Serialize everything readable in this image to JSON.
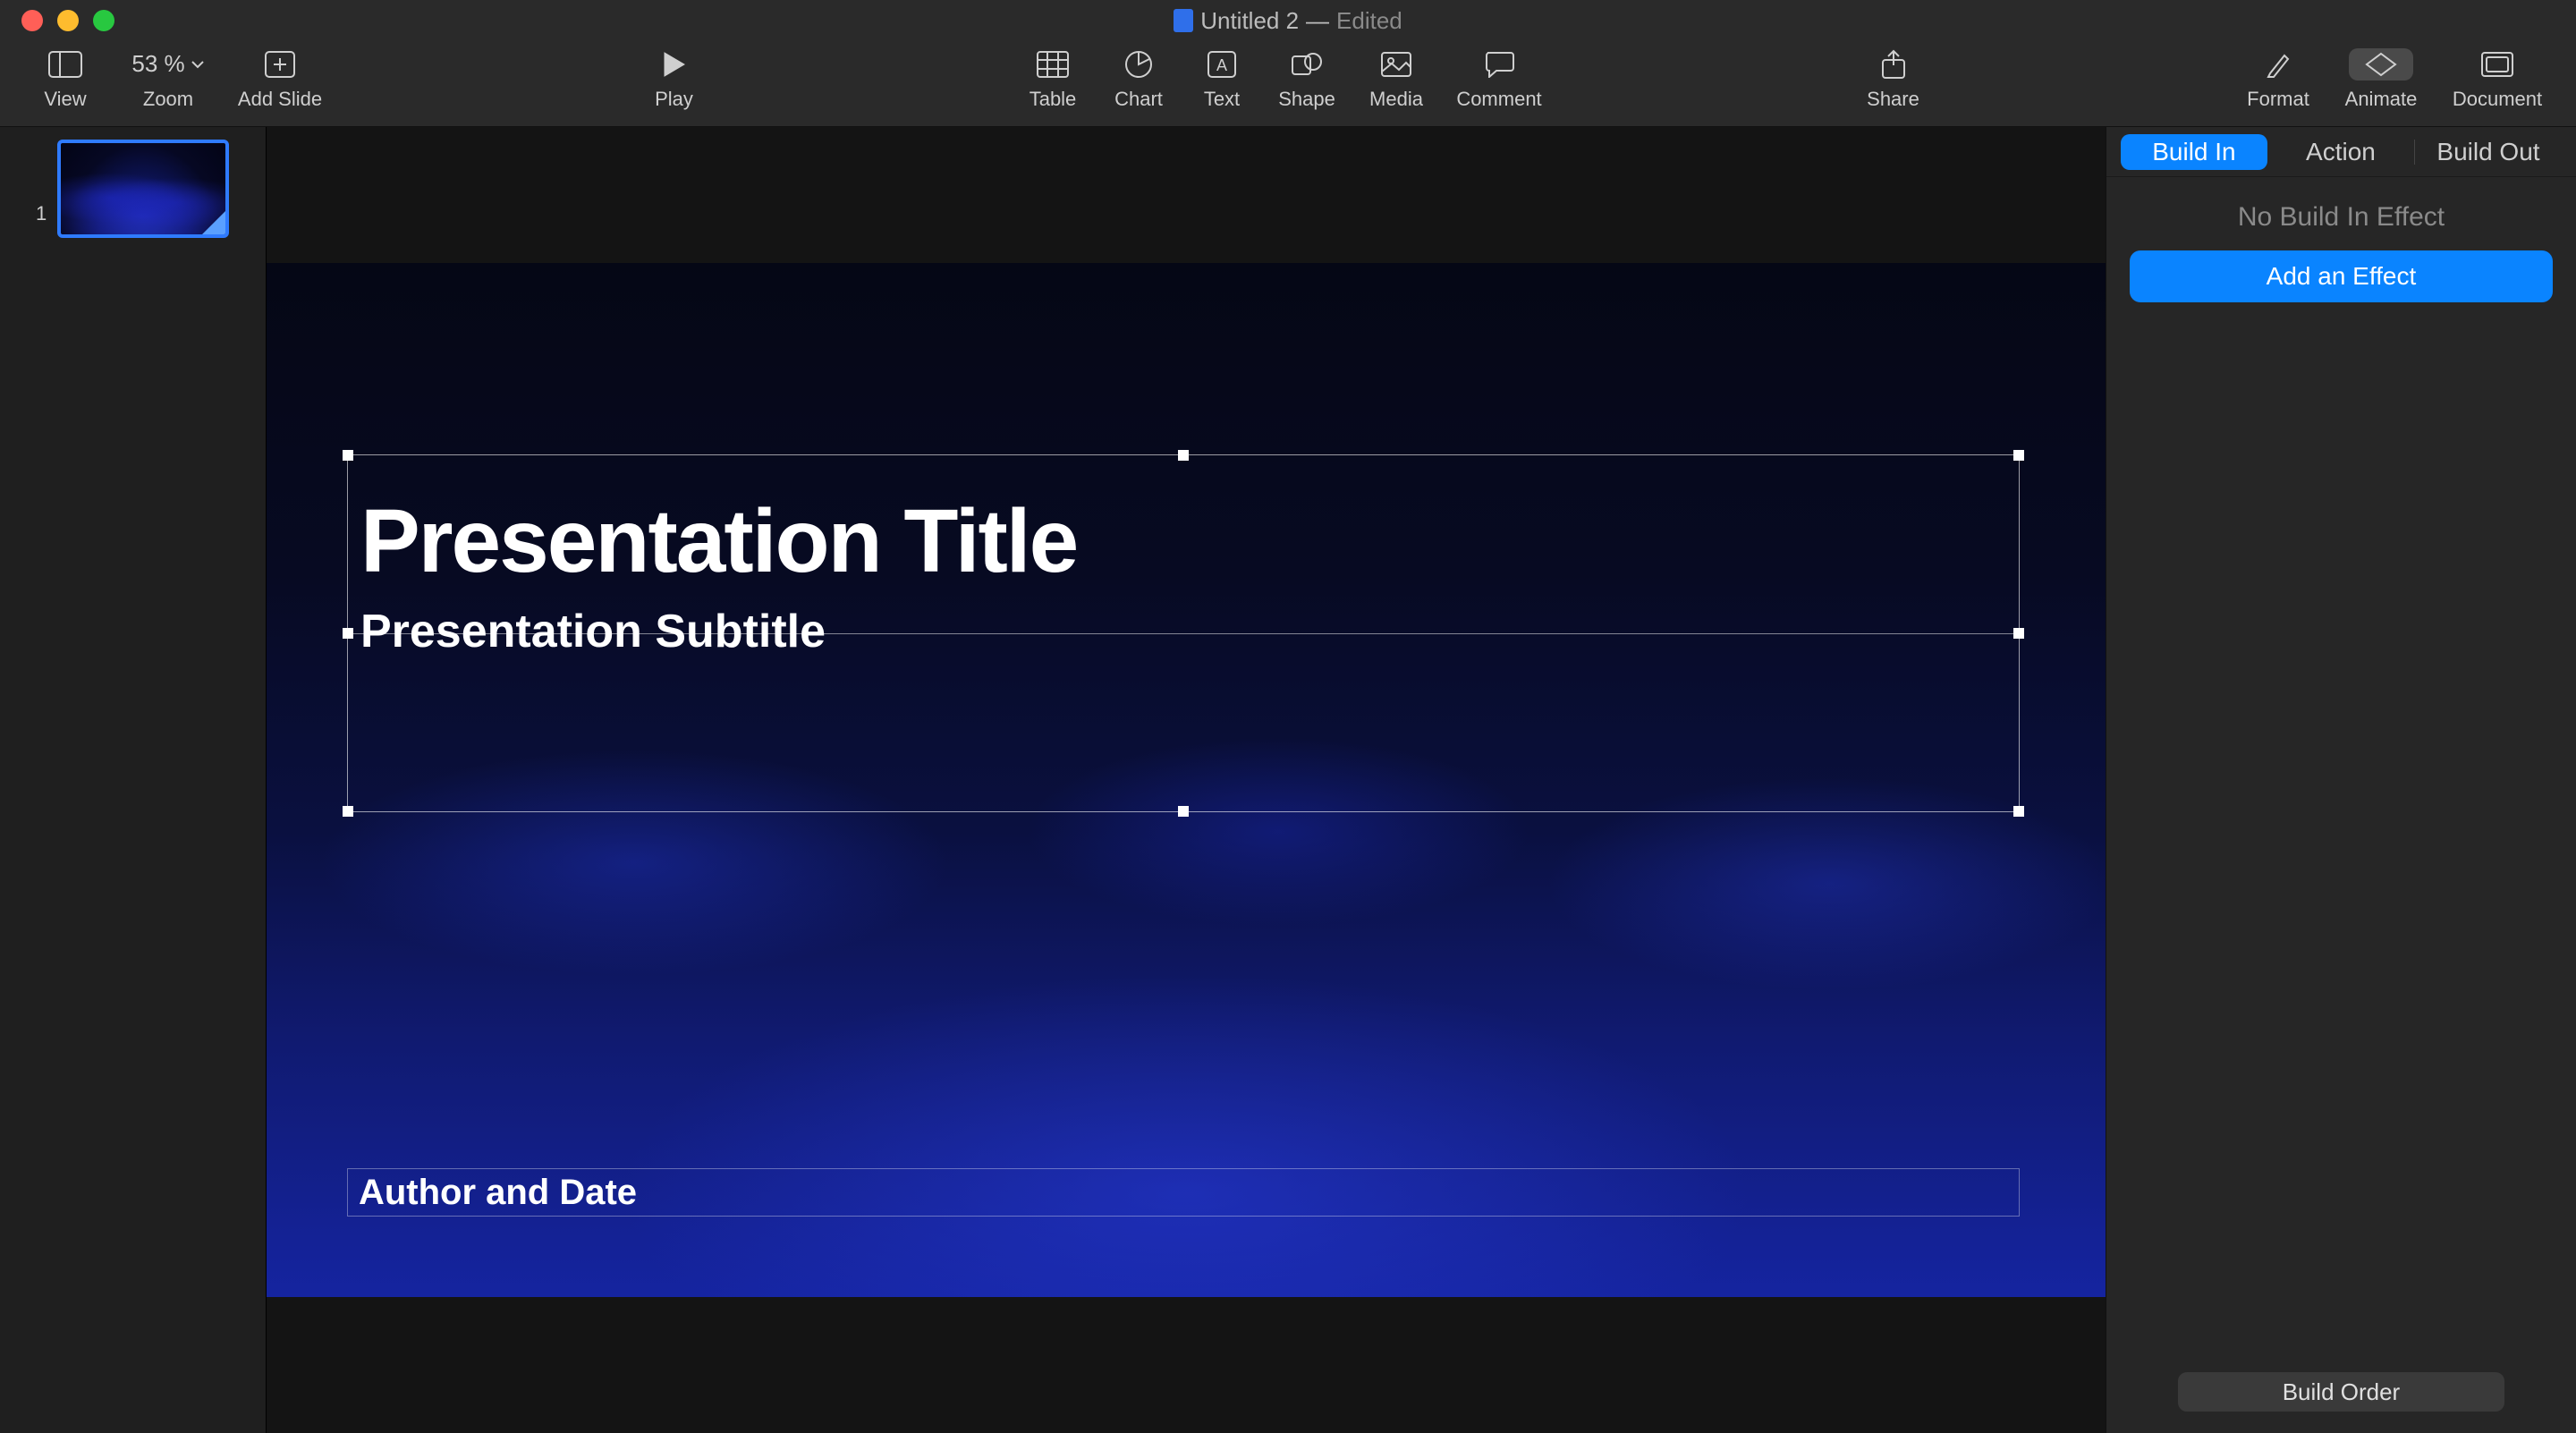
{
  "titlebar": {
    "document_name": "Untitled 2",
    "separator": "—",
    "status": "Edited"
  },
  "toolbar": {
    "view": "View",
    "zoom_label": "Zoom",
    "zoom_value": "53 %",
    "add_slide": "Add Slide",
    "play": "Play",
    "table": "Table",
    "chart": "Chart",
    "text": "Text",
    "shape": "Shape",
    "media": "Media",
    "comment": "Comment",
    "share": "Share",
    "format": "Format",
    "animate": "Animate",
    "document": "Document"
  },
  "navigator": {
    "slides": [
      {
        "index": "1"
      }
    ]
  },
  "slide": {
    "title": "Presentation Title",
    "subtitle": "Presentation Subtitle",
    "author": "Author and Date"
  },
  "inspector": {
    "tabs": {
      "build_in": "Build In",
      "action": "Action",
      "build_out": "Build Out"
    },
    "no_effect": "No Build In Effect",
    "add_effect": "Add an Effect",
    "build_order": "Build Order"
  }
}
